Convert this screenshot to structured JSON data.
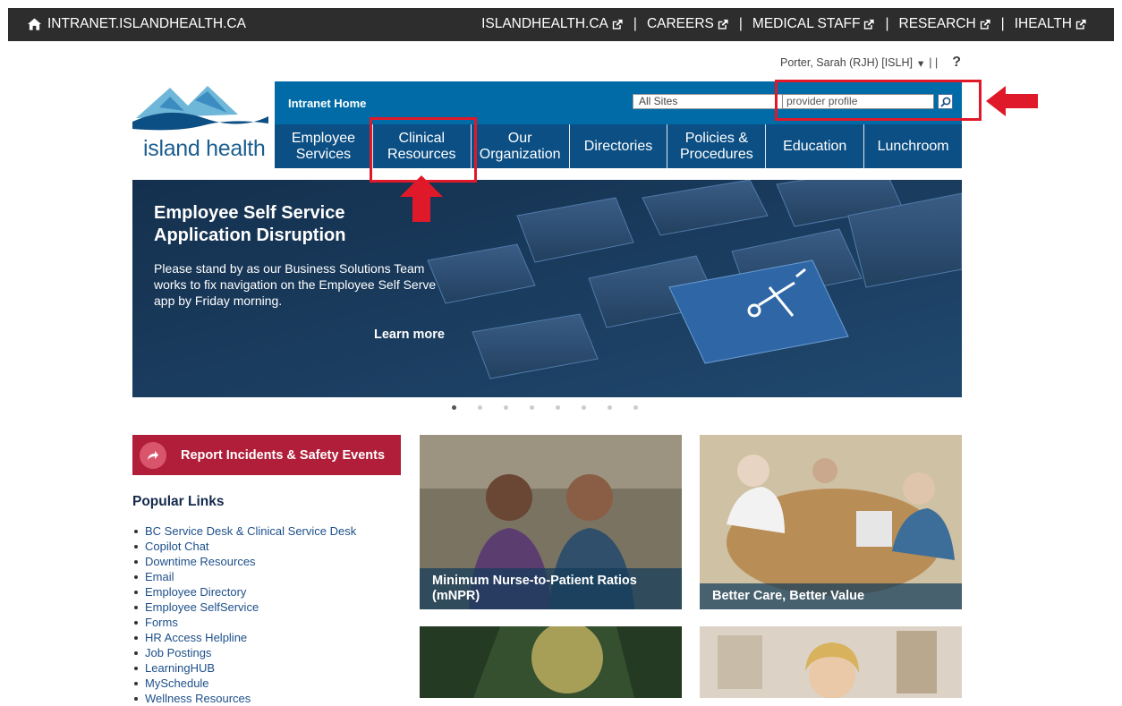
{
  "topbar": {
    "home_label": "INTRANET.ISLANDHEALTH.CA",
    "links": [
      "ISLANDHEALTH.CA",
      "CAREERS",
      "MEDICAL STAFF",
      "RESEARCH",
      "IHEALTH"
    ],
    "separator": "|"
  },
  "user": {
    "name": "Porter, Sarah (RJH) [ISLH]",
    "pipes": "| |",
    "help": "?"
  },
  "logo": {
    "wordmark": "island health"
  },
  "header": {
    "home_link": "Intranet Home",
    "site_select": "All Sites",
    "search_value": "provider profile"
  },
  "nav": [
    {
      "line1": "Employee",
      "line2": "Services"
    },
    {
      "line1": "Clinical",
      "line2": "Resources"
    },
    {
      "line1": "Our",
      "line2": "Organization"
    },
    {
      "line1": "Directories",
      "line2": ""
    },
    {
      "line1": "Policies &",
      "line2": "Procedures"
    },
    {
      "line1": "Education",
      "line2": ""
    },
    {
      "line1": "Lunchroom",
      "line2": ""
    }
  ],
  "hero": {
    "title": "Employee Self Service Application Disruption",
    "body": "Please stand by as our Business Solutions Team works to fix navigation on the Employee Self Serve app by Friday morning.",
    "cta": "Learn more",
    "slide_count": 8,
    "active_slide": 1
  },
  "report_button": "Report Incidents & Safety Events",
  "popular": {
    "heading": "Popular Links",
    "items": [
      "BC Service Desk & Clinical Service Desk",
      "Copilot Chat",
      "Downtime Resources",
      "Email",
      "Employee Directory",
      "Employee SelfService",
      "Forms",
      "HR Access Helpline",
      "Job Postings",
      "LearningHUB",
      "MySchedule",
      "Wellness Resources"
    ]
  },
  "tiles": [
    {
      "caption": "Minimum Nurse-to-Patient Ratios (mNPR)"
    },
    {
      "caption": "Better Care, Better Value"
    },
    {
      "caption": ""
    },
    {
      "caption": ""
    }
  ],
  "colors": {
    "topbar": "#2d2d2d",
    "header_blue": "#006ba6",
    "nav_blue": "#0c4f84",
    "report_red": "#b01e39",
    "annotation_red": "#e0192a"
  }
}
